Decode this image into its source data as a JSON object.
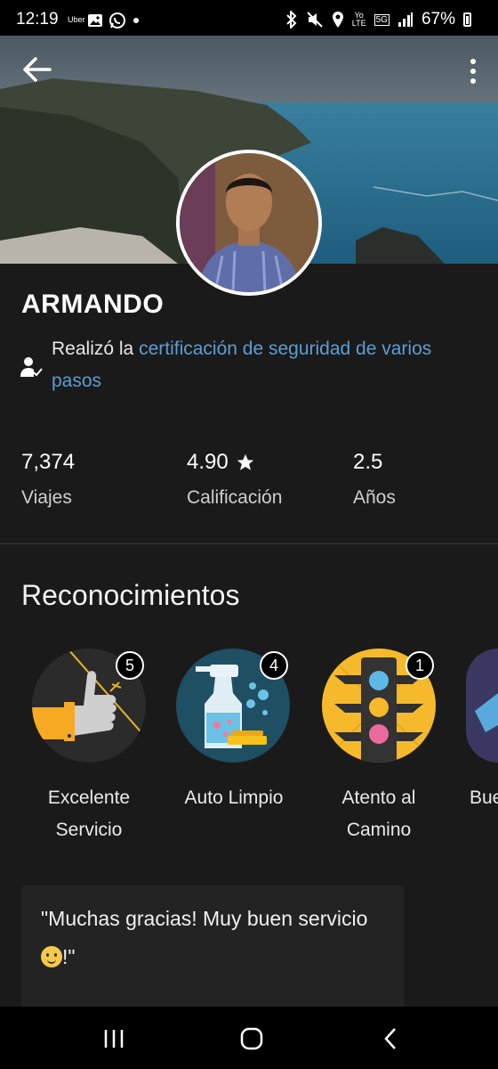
{
  "status_bar": {
    "time": "12:19",
    "uber_label": "Uber",
    "lte_top": "Yo",
    "lte_bottom": "LTE",
    "network": "5G",
    "battery": "67%",
    "icons": [
      "image-icon",
      "whatsapp-icon",
      "dot-icon",
      "bluetooth-icon",
      "mute-icon",
      "location-icon",
      "signal-icon",
      "battery-icon"
    ]
  },
  "header": {
    "back_icon": "arrow-left-icon",
    "menu_icon": "more-vertical-icon"
  },
  "profile": {
    "name": "ARMANDO",
    "cert_prefix": "Realizó la ",
    "cert_link": "certificación de seguridad de varios pasos"
  },
  "stats": [
    {
      "value": "7,374",
      "label": "Viajes"
    },
    {
      "value": "4.90",
      "label": "Calificación",
      "icon": "star-icon"
    },
    {
      "value": "2.5",
      "label": "Años"
    }
  ],
  "recognitions": {
    "title": "Reconocimientos",
    "items": [
      {
        "count": "5",
        "label": "Excelente Servicio",
        "icon": "thumbs-up-icon"
      },
      {
        "count": "4",
        "label": "Auto Limpio",
        "icon": "spray-bottle-icon"
      },
      {
        "count": "1",
        "label": "Atento al Camino",
        "icon": "traffic-light-icon"
      },
      {
        "label": "Bue",
        "icon": "partial-badge-icon"
      }
    ]
  },
  "review": {
    "text_before": "\"Muchas gracias!  Muy buen servicio ",
    "text_after": "!\""
  },
  "colors": {
    "background": "#1a1a1a",
    "link": "#5a9fd6",
    "badge_dark": "#2b2b2b",
    "badge_teal": "#1f4f63",
    "badge_yellow": "#f6b92b"
  }
}
